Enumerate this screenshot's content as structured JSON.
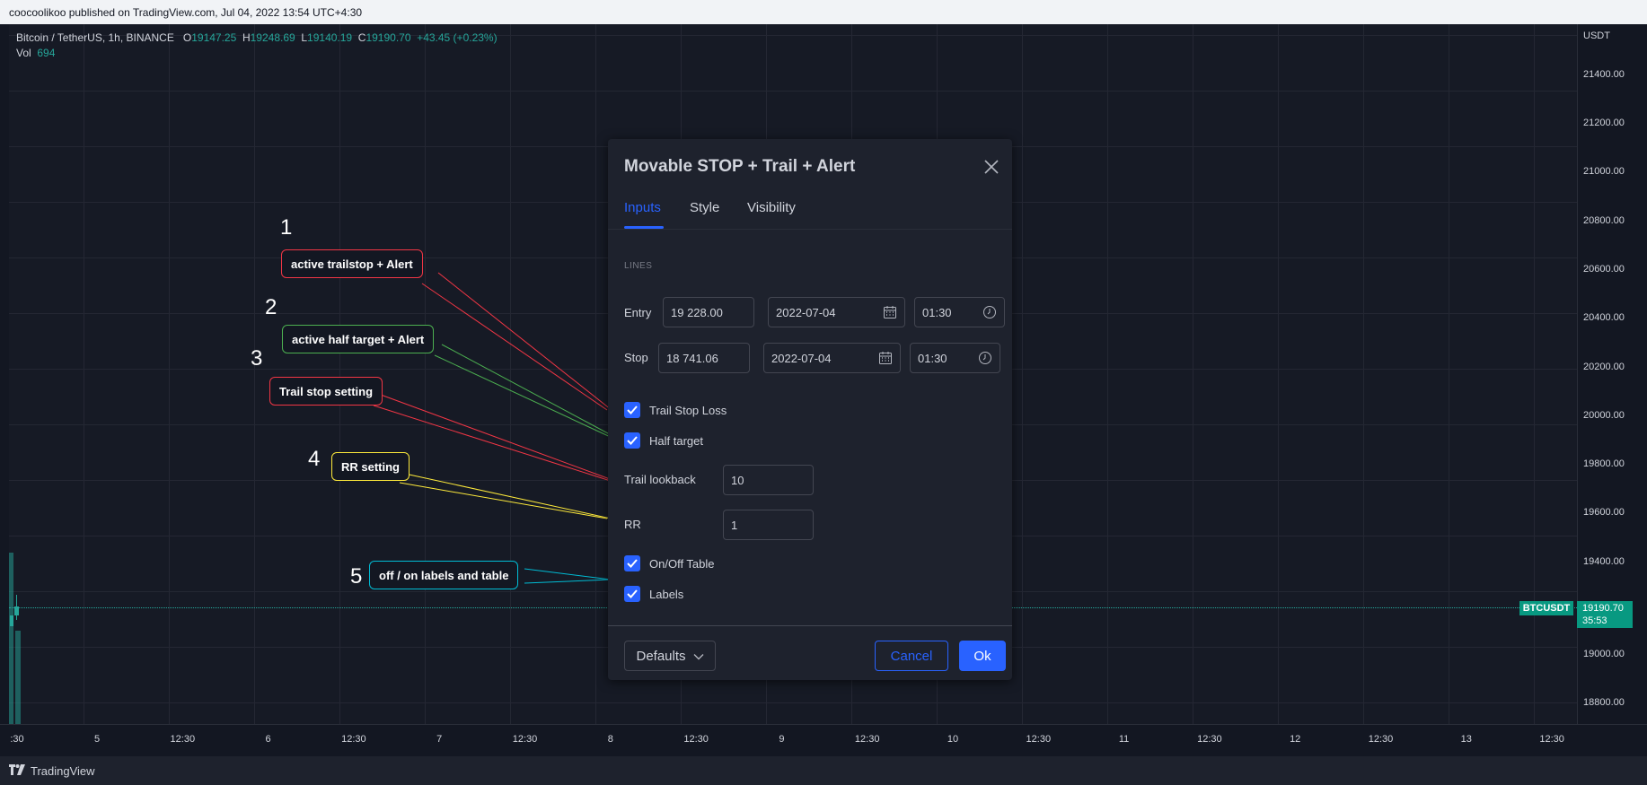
{
  "header": {
    "published": "coocoolikoo published on TradingView.com, Jul 04, 2022 13:54 UTC+4:30"
  },
  "chart": {
    "symbol": "Bitcoin / TetherUS, 1h, BINANCE",
    "o_label": "O",
    "o": "19147.25",
    "h_label": "H",
    "h": "19248.69",
    "l_label": "L",
    "l": "19140.19",
    "c_label": "C",
    "c": "19190.70",
    "change": "+43.45 (+0.23%)",
    "vol_label": "Vol",
    "vol": "694",
    "currency": "USDT",
    "price_ticks": [
      "21400.00",
      "21200.00",
      "21000.00",
      "20800.00",
      "20600.00",
      "20400.00",
      "20200.00",
      "20000.00",
      "19800.00",
      "19600.00",
      "19400.00",
      "19000.00",
      "18800.00"
    ],
    "time_ticks": [
      ":30",
      "5",
      "12:30",
      "6",
      "12:30",
      "7",
      "12:30",
      "8",
      "12:30",
      "9",
      "12:30",
      "10",
      "12:30",
      "11",
      "12:30",
      "12",
      "12:30",
      "13",
      "12:30"
    ],
    "symbol_badge": "BTCUSDT",
    "last_price": "19190.70",
    "countdown": "35:53",
    "up_color": "#26a69a"
  },
  "footer": {
    "brand": "TradingView"
  },
  "dialog": {
    "title": "Movable STOP + Trail + Alert",
    "tabs": [
      "Inputs",
      "Style",
      "Visibility"
    ],
    "section": "LINES",
    "entry": {
      "label": "Entry",
      "price": "19 228.00",
      "date": "2022-07-04",
      "time": "01:30"
    },
    "stop": {
      "label": "Stop",
      "price": "18 741.06",
      "date": "2022-07-04",
      "time": "01:30"
    },
    "checkboxes": [
      "Trail Stop Loss",
      "Half target",
      "On/Off Table",
      "Labels"
    ],
    "trail_lookback": {
      "label": "Trail lookback",
      "value": "10"
    },
    "rr": {
      "label": "RR",
      "value": "1"
    },
    "buttons": {
      "defaults": "Defaults",
      "cancel": "Cancel",
      "ok": "Ok"
    },
    "accent": "#2962ff"
  },
  "annotations": [
    {
      "num": "1",
      "text": "active trailstop + Alert",
      "color": "#f23645"
    },
    {
      "num": "2",
      "text": "active half target + Alert",
      "color": "#4caf50"
    },
    {
      "num": "3",
      "text": "Trail stop setting",
      "color": "#f23645"
    },
    {
      "num": "4",
      "text": "RR setting",
      "color": "#ffeb3b"
    },
    {
      "num": "5",
      "text": "off / on labels and table",
      "color": "#00bcd4"
    }
  ]
}
